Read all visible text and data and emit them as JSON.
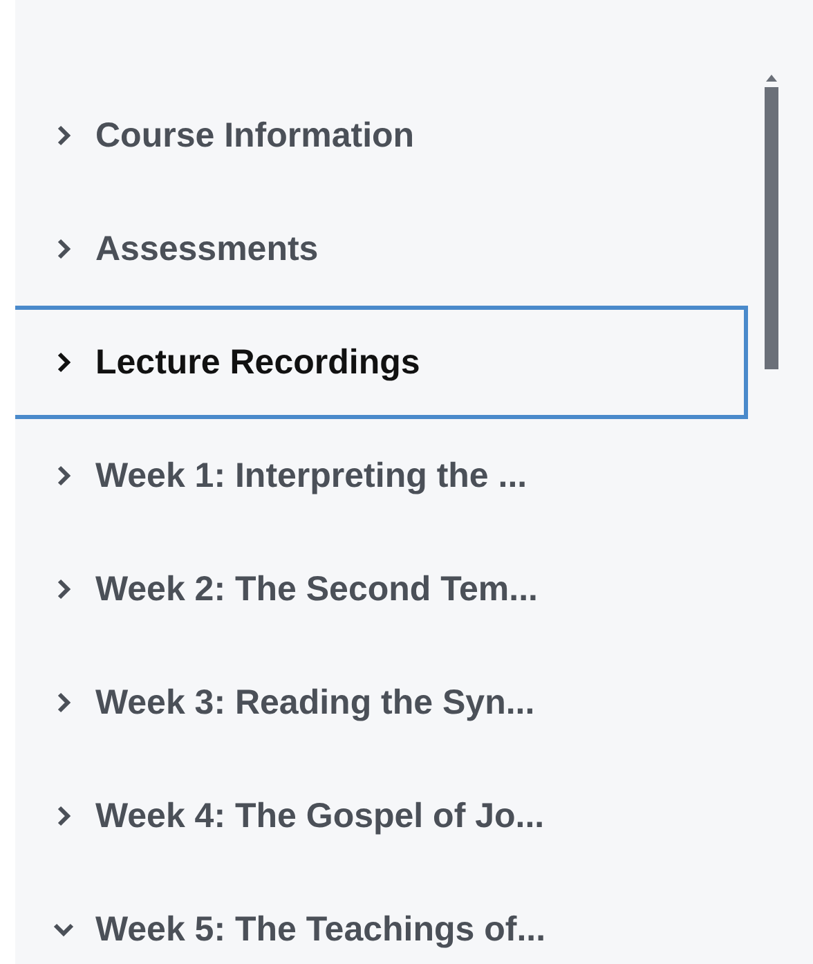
{
  "outline": {
    "items": [
      {
        "label": "Course Information",
        "expanded": false,
        "selected": false
      },
      {
        "label": "Assessments",
        "expanded": false,
        "selected": false
      },
      {
        "label": "Lecture Recordings",
        "expanded": false,
        "selected": true
      },
      {
        "label": "Week 1: Interpreting the ...",
        "expanded": false,
        "selected": false
      },
      {
        "label": "Week 2: The Second Tem...",
        "expanded": false,
        "selected": false
      },
      {
        "label": "Week 3: Reading the Syn...",
        "expanded": false,
        "selected": false
      },
      {
        "label": "Week 4: The Gospel of Jo...",
        "expanded": false,
        "selected": false
      },
      {
        "label": "Week 5: The Teachings of...",
        "expanded": true,
        "selected": false
      }
    ]
  }
}
